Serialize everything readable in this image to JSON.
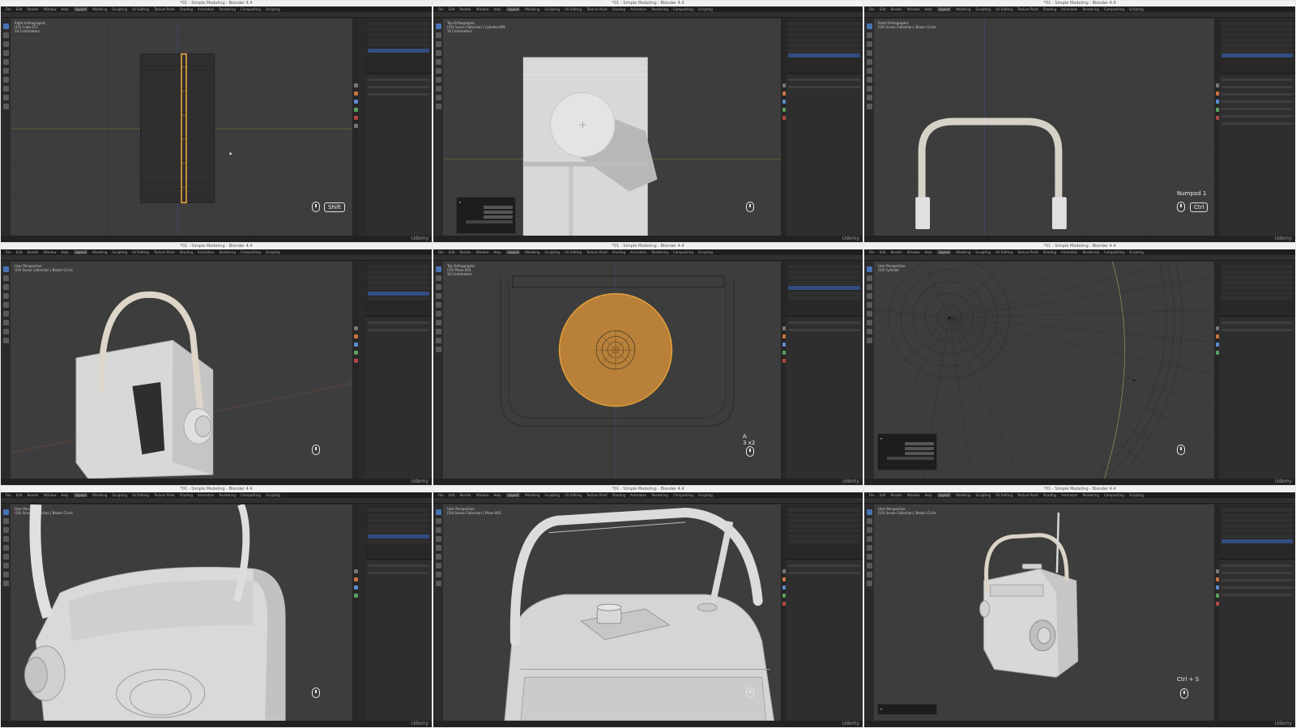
{
  "window_title": "*01 - Simple Modeling - Blender 4.4",
  "app_logo": "Udemy",
  "menu_items": [
    "File",
    "Edit",
    "Render",
    "Window",
    "Help",
    "Layout",
    "Modeling",
    "Sculpting",
    "UV Editing",
    "Texture Paint",
    "Shading",
    "Animation",
    "Rendering",
    "Compositing",
    "Scripting"
  ],
  "key_hints": {
    "shift": "Shift",
    "numpad": "Numpad 1",
    "ctrl": "Ctrl",
    "a3x2_line1": "A",
    "a3x2_line2": "3 x2",
    "ctrl_s": "Ctrl + S"
  },
  "viewport_info": {
    "p1": [
      "Right Orthographic",
      "(19) Cube.017",
      "10 Centimeters"
    ],
    "p2": [
      "Top Orthographic",
      "(19) Scene Collection | Cylinder.009",
      "10 Centimeters"
    ],
    "p3": [
      "Front Orthographic",
      "(19) Scene Collection | Bezier Circle"
    ],
    "p4": [
      "User Perspective",
      "(19) Scene Collection | Bezier Circle"
    ],
    "p5": [
      "Top Orthographic",
      "(19) Plane.003",
      "10 Centimeters"
    ],
    "p6": [
      "User Perspective",
      "(19) Cylinder"
    ],
    "p7": [
      "User Perspective",
      "(19) Scene Collection | Bezier Circle"
    ],
    "p8": [
      "User Perspective",
      "(19) Scene Collection | Plane.003"
    ],
    "p9": [
      "User Perspective",
      "(19) Scene Collection | Bezier Circle"
    ]
  },
  "colors": {
    "selection": "#e8a33a",
    "ui_dark": "#2a2a2a",
    "viewport": "#3d3d3d",
    "mesh": "#e2e2e2",
    "highlight": "#4772b3"
  }
}
